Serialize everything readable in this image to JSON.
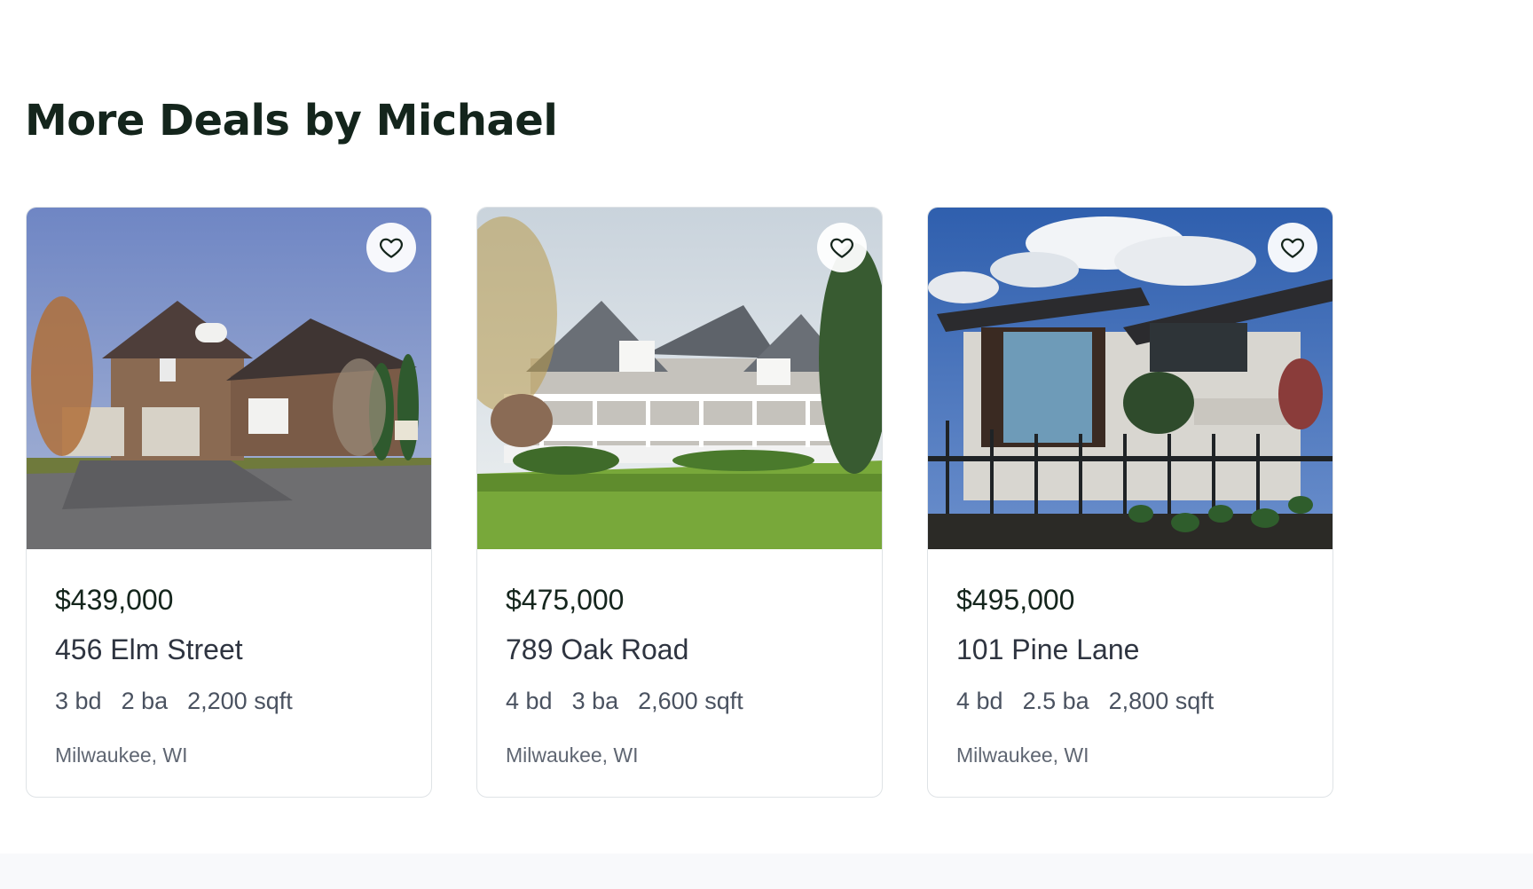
{
  "section": {
    "title": "More Deals by Michael"
  },
  "listings": [
    {
      "price": "$439,000",
      "address": "456 Elm Street",
      "beds": "3 bd",
      "baths": "2 ba",
      "sqft": "2,200 sqft",
      "location": "Milwaukee, WI",
      "favorite_icon": "heart-outline-icon"
    },
    {
      "price": "$475,000",
      "address": "789 Oak Road",
      "beds": "4 bd",
      "baths": "3 ba",
      "sqft": "2,600 sqft",
      "location": "Milwaukee, WI",
      "favorite_icon": "heart-outline-icon"
    },
    {
      "price": "$495,000",
      "address": "101 Pine Lane",
      "beds": "4 bd",
      "baths": "2.5 ba",
      "sqft": "2,800 sqft",
      "location": "Milwaukee, WI",
      "favorite_icon": "heart-outline-icon"
    }
  ],
  "colors": {
    "heading": "#14251c",
    "card_border": "#dfe3e6",
    "muted_text": "#5f6672",
    "footer_band": "#f8f9fb"
  }
}
